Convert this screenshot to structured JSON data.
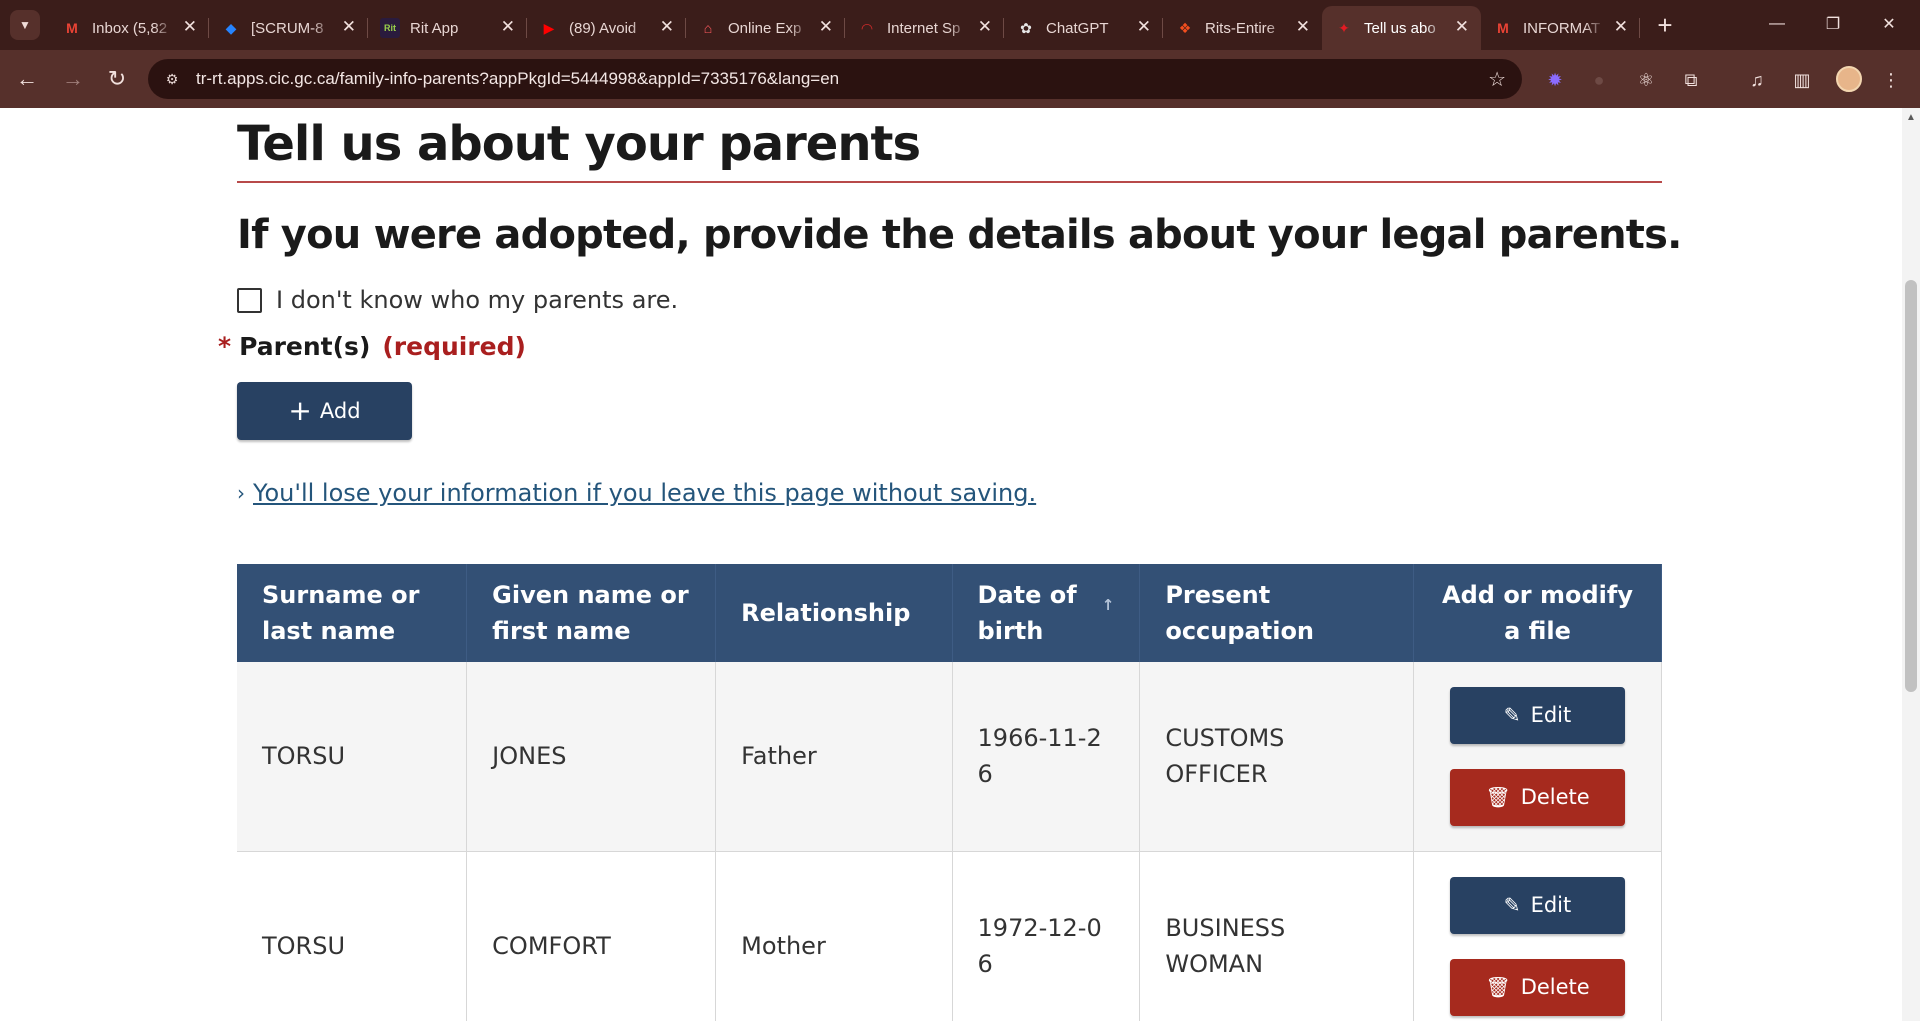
{
  "browser": {
    "tabs": [
      {
        "title": "Inbox (5,82",
        "icon": "gmail-icon",
        "glyph": "M",
        "color": "#ea4335"
      },
      {
        "title": "[SCRUM-8",
        "icon": "jira-icon",
        "glyph": "◆",
        "color": "#2684ff"
      },
      {
        "title": "Rit App",
        "icon": "rit-app-icon",
        "glyph": "Rit",
        "color": "#9ad14b"
      },
      {
        "title": "(89) Avoid",
        "icon": "youtube-icon",
        "glyph": "▶",
        "color": "#ff0000"
      },
      {
        "title": "Online Exp",
        "icon": "airbnb-icon",
        "glyph": "⌂",
        "color": "#ff5a5f"
      },
      {
        "title": "Internet Sp",
        "icon": "speedtest-icon",
        "glyph": "◠",
        "color": "#d62b2b"
      },
      {
        "title": "ChatGPT",
        "icon": "chatgpt-icon",
        "glyph": "✿",
        "color": "#e8e8e8"
      },
      {
        "title": "Rits-Entire",
        "icon": "figma-icon",
        "glyph": "❖",
        "color": "#f24e1e"
      },
      {
        "title": "Tell us abo",
        "icon": "canada-flag-icon",
        "glyph": "✦",
        "color": "#e31b23",
        "active": true
      },
      {
        "title": "INFORMAT",
        "icon": "gmail-icon",
        "glyph": "M",
        "color": "#ea4335"
      }
    ],
    "url": "tr-rt.apps.cic.gc.ca/family-info-parents?appPkgId=5444998&appId=7335176&lang=en"
  },
  "page": {
    "title": "Tell us about your parents",
    "subtitle": "If you were adopted, provide the details about your legal parents.",
    "unknown_checkbox_label": "I don't know who my parents are.",
    "unknown_checked": false,
    "parents_label": "Parent(s)",
    "required_marker": "*",
    "required_text": "(required)",
    "add_label": "Add",
    "warning_link": "You'll lose your information if you leave this page without saving."
  },
  "table": {
    "headers": [
      "Surname or last name",
      "Given name or first name",
      "Relationship",
      "Date of birth",
      "Present occupation",
      "Add or modify a file"
    ],
    "rows": [
      {
        "surname": "TORSU",
        "given": "JONES",
        "relationship": "Father",
        "dob": "1966-11-26",
        "occupation": "CUSTOMS OFFICER"
      },
      {
        "surname": "TORSU",
        "given": "COMFORT",
        "relationship": "Mother",
        "dob": "1972-12-06",
        "occupation": "BUSINESS WOMAN"
      }
    ],
    "edit_label": "Edit",
    "delete_label": "Delete"
  },
  "colors": {
    "primary_button": "#284162",
    "danger_button": "#a62a1e",
    "table_header": "#335075",
    "required_red": "#a91f1f",
    "link_blue": "#24557b"
  }
}
